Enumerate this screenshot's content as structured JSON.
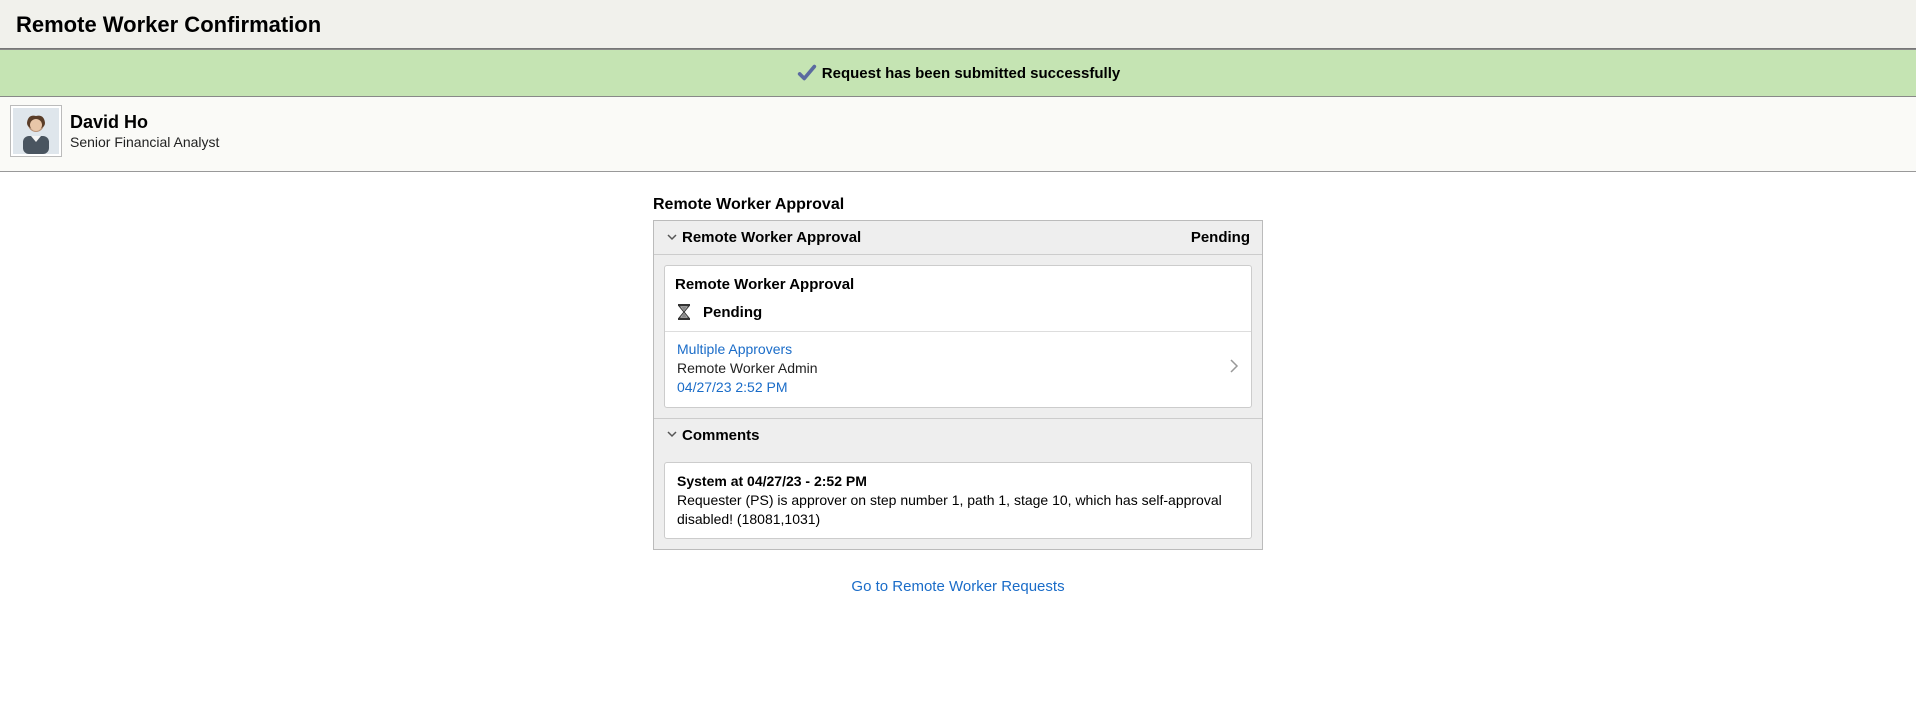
{
  "page": {
    "title": "Remote Worker Confirmation"
  },
  "banner": {
    "message": "Request has been submitted successfully"
  },
  "employee": {
    "name": "David Ho",
    "title": "Senior Financial Analyst"
  },
  "approval": {
    "section_heading": "Remote Worker Approval",
    "panel_title": "Remote Worker Approval",
    "panel_status": "Pending",
    "card_title": "Remote Worker Approval",
    "status_label": "Pending",
    "approver_link": "Multiple Approvers",
    "approver_role": "Remote Worker Admin",
    "timestamp": "04/27/23 2:52 PM"
  },
  "comments": {
    "header": "Comments",
    "entry": {
      "header": "System at 04/27/23 - 2:52 PM",
      "body": "Requester (PS) is approver on step number 1, path 1, stage 10, which has self-approval disabled! (18081,1031)"
    }
  },
  "footer": {
    "link_label": "Go to Remote Worker Requests"
  }
}
